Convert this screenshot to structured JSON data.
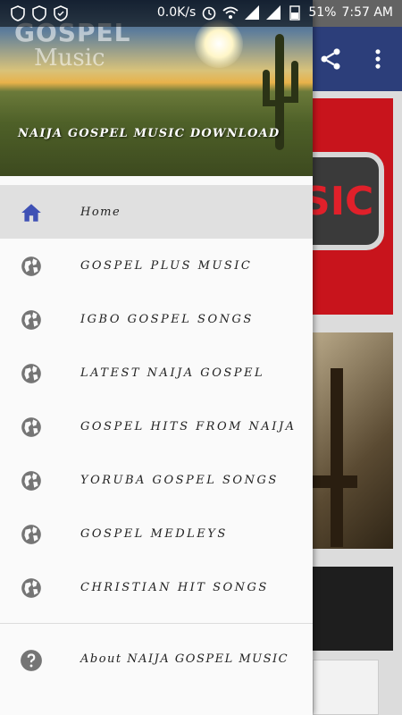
{
  "status_bar": {
    "network_speed": "0.0K/s",
    "battery": "51%",
    "time": "7:57 AM"
  },
  "header": {
    "logo_line1": "GOSPEL",
    "logo_line2": "Music",
    "title": "NAIJA GOSPEL MUSIC DOWNLOAD"
  },
  "menu": {
    "items": [
      {
        "label": "Home",
        "icon": "home-icon"
      },
      {
        "label": "GOSPEL PLUS MUSIC",
        "icon": "globe-icon"
      },
      {
        "label": "IGBO GOSPEL SONGS",
        "icon": "globe-icon"
      },
      {
        "label": "LATEST NAIJA GOSPEL",
        "icon": "globe-icon"
      },
      {
        "label": "GOSPEL HITS FROM NAIJA",
        "icon": "globe-icon"
      },
      {
        "label": "YORUBA GOSPEL SONGS",
        "icon": "globe-icon"
      },
      {
        "label": "GOSPEL MEDLEYS",
        "icon": "globe-icon"
      },
      {
        "label": "CHRISTIAN HIT SONGS",
        "icon": "globe-icon"
      }
    ],
    "about_label": "About NAIJA GOSPEL MUSIC"
  },
  "background": {
    "card_logo_text": "SIC"
  },
  "colors": {
    "accent": "#3f51b5",
    "icon_gray": "#757575",
    "toolbar": "#2c3e7a",
    "selected_bg": "#e0e0e0"
  }
}
